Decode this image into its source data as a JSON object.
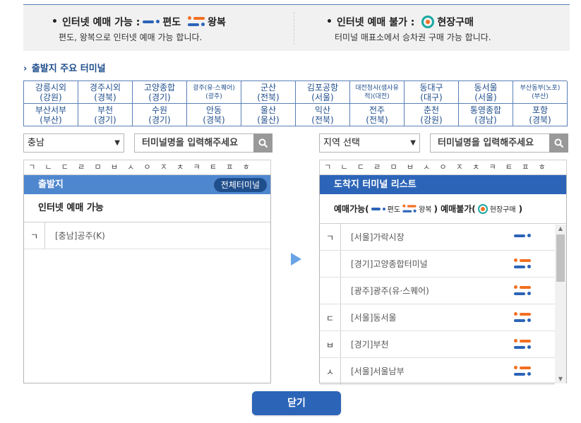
{
  "info": {
    "bullet": "•",
    "available_label": "인터넷 예매 가능 :",
    "oneway_label": "편도",
    "round_label": "왕복",
    "available_desc": "편도, 왕복으로 인터넷 예매 가능 합니다.",
    "unavailable_label": "인터넷 예매 불가 :",
    "onsite_label": "현장구매",
    "unavailable_desc": "터미널 매표소에서 승차권 구매 가능 합니다."
  },
  "section_title": "출발지 주요 터미널",
  "terminals": [
    {
      "l1": "강릉시외",
      "l2": "(강원)",
      "small": false
    },
    {
      "l1": "경주시외",
      "l2": "(경북)",
      "small": false
    },
    {
      "l1": "고양종합",
      "l2": "(경기)",
      "small": false
    },
    {
      "l1": "광주(유·스퀘어)",
      "l2": "(광주)",
      "small": true
    },
    {
      "l1": "군산",
      "l2": "(전북)",
      "small": false
    },
    {
      "l1": "김포공항",
      "l2": "(서울)",
      "small": false
    },
    {
      "l1": "대전청사(샘사유",
      "l2": "적)(대전)",
      "small": true
    },
    {
      "l1": "동대구",
      "l2": "(대구)",
      "small": false
    },
    {
      "l1": "동서울",
      "l2": "(서울)",
      "small": false
    },
    {
      "l1": "부산동부(노포)",
      "l2": "(부산)",
      "small": true
    },
    {
      "l1": "부산서부",
      "l2": "(부산)",
      "small": false
    },
    {
      "l1": "부천",
      "l2": "(경기)",
      "small": false
    },
    {
      "l1": "수원",
      "l2": "(경기)",
      "small": false
    },
    {
      "l1": "안동",
      "l2": "(경북)",
      "small": false
    },
    {
      "l1": "울산",
      "l2": "(울산)",
      "small": false
    },
    {
      "l1": "익산",
      "l2": "(전북)",
      "small": false
    },
    {
      "l1": "전주",
      "l2": "(전북)",
      "small": false
    },
    {
      "l1": "춘천",
      "l2": "(강원)",
      "small": false
    },
    {
      "l1": "통영종합",
      "l2": "(경남)",
      "small": false
    },
    {
      "l1": "포항",
      "l2": "(경북)",
      "small": false
    }
  ],
  "left": {
    "region_value": "충남",
    "search_placeholder": "터미널명을 입력해주세요",
    "chosung": [
      "ㄱ",
      "ㄴ",
      "ㄷ",
      "ㄹ",
      "ㅁ",
      "ㅂ",
      "ㅅ",
      "ㅇ",
      "ㅈ",
      "ㅊ",
      "ㅋ",
      "ㅌ",
      "ㅍ",
      "ㅎ"
    ],
    "header": "출발지",
    "all_button": "전체터미널",
    "sub_header": "인터넷 예매 가능",
    "rows": [
      {
        "initial": "ㄱ",
        "name": "[충남]공주(K)"
      }
    ]
  },
  "right": {
    "region_value": "지역 선택",
    "search_placeholder": "터미널명을 입력해주세요",
    "chosung": [
      "ㄱ",
      "ㄴ",
      "ㄷ",
      "ㄹ",
      "ㅁ",
      "ㅂ",
      "ㅅ",
      "ㅇ",
      "ㅈ",
      "ㅊ",
      "ㅋ",
      "ㅌ",
      "ㅍ",
      "ㅎ"
    ],
    "header": "도착지 터미널 리스트",
    "legend": {
      "available": "예매가능(",
      "oneway": "편도",
      "round": "왕복",
      "close_open": ") 예매불가(",
      "onsite": "현장구매",
      "close": ")"
    },
    "rows": [
      {
        "initial": "ㄱ",
        "name": "[서울]가락시장",
        "type": "oneway"
      },
      {
        "initial": "",
        "name": "[경기]고양종합터미널",
        "type": "round"
      },
      {
        "initial": "",
        "name": "[광주]광주(유·스퀘어)",
        "type": "round"
      },
      {
        "initial": "ㄷ",
        "name": "[서울]동서울",
        "type": "round"
      },
      {
        "initial": "ㅂ",
        "name": "[경기]부천",
        "type": "round"
      },
      {
        "initial": "ㅅ",
        "name": "[서울]서울남부",
        "type": "round"
      }
    ]
  },
  "close_button": "닫기",
  "colors": {
    "primary": "#2c64b8",
    "header_light": "#4f87cf",
    "orange": "#f36f21",
    "teal": "#1aa8a0"
  }
}
